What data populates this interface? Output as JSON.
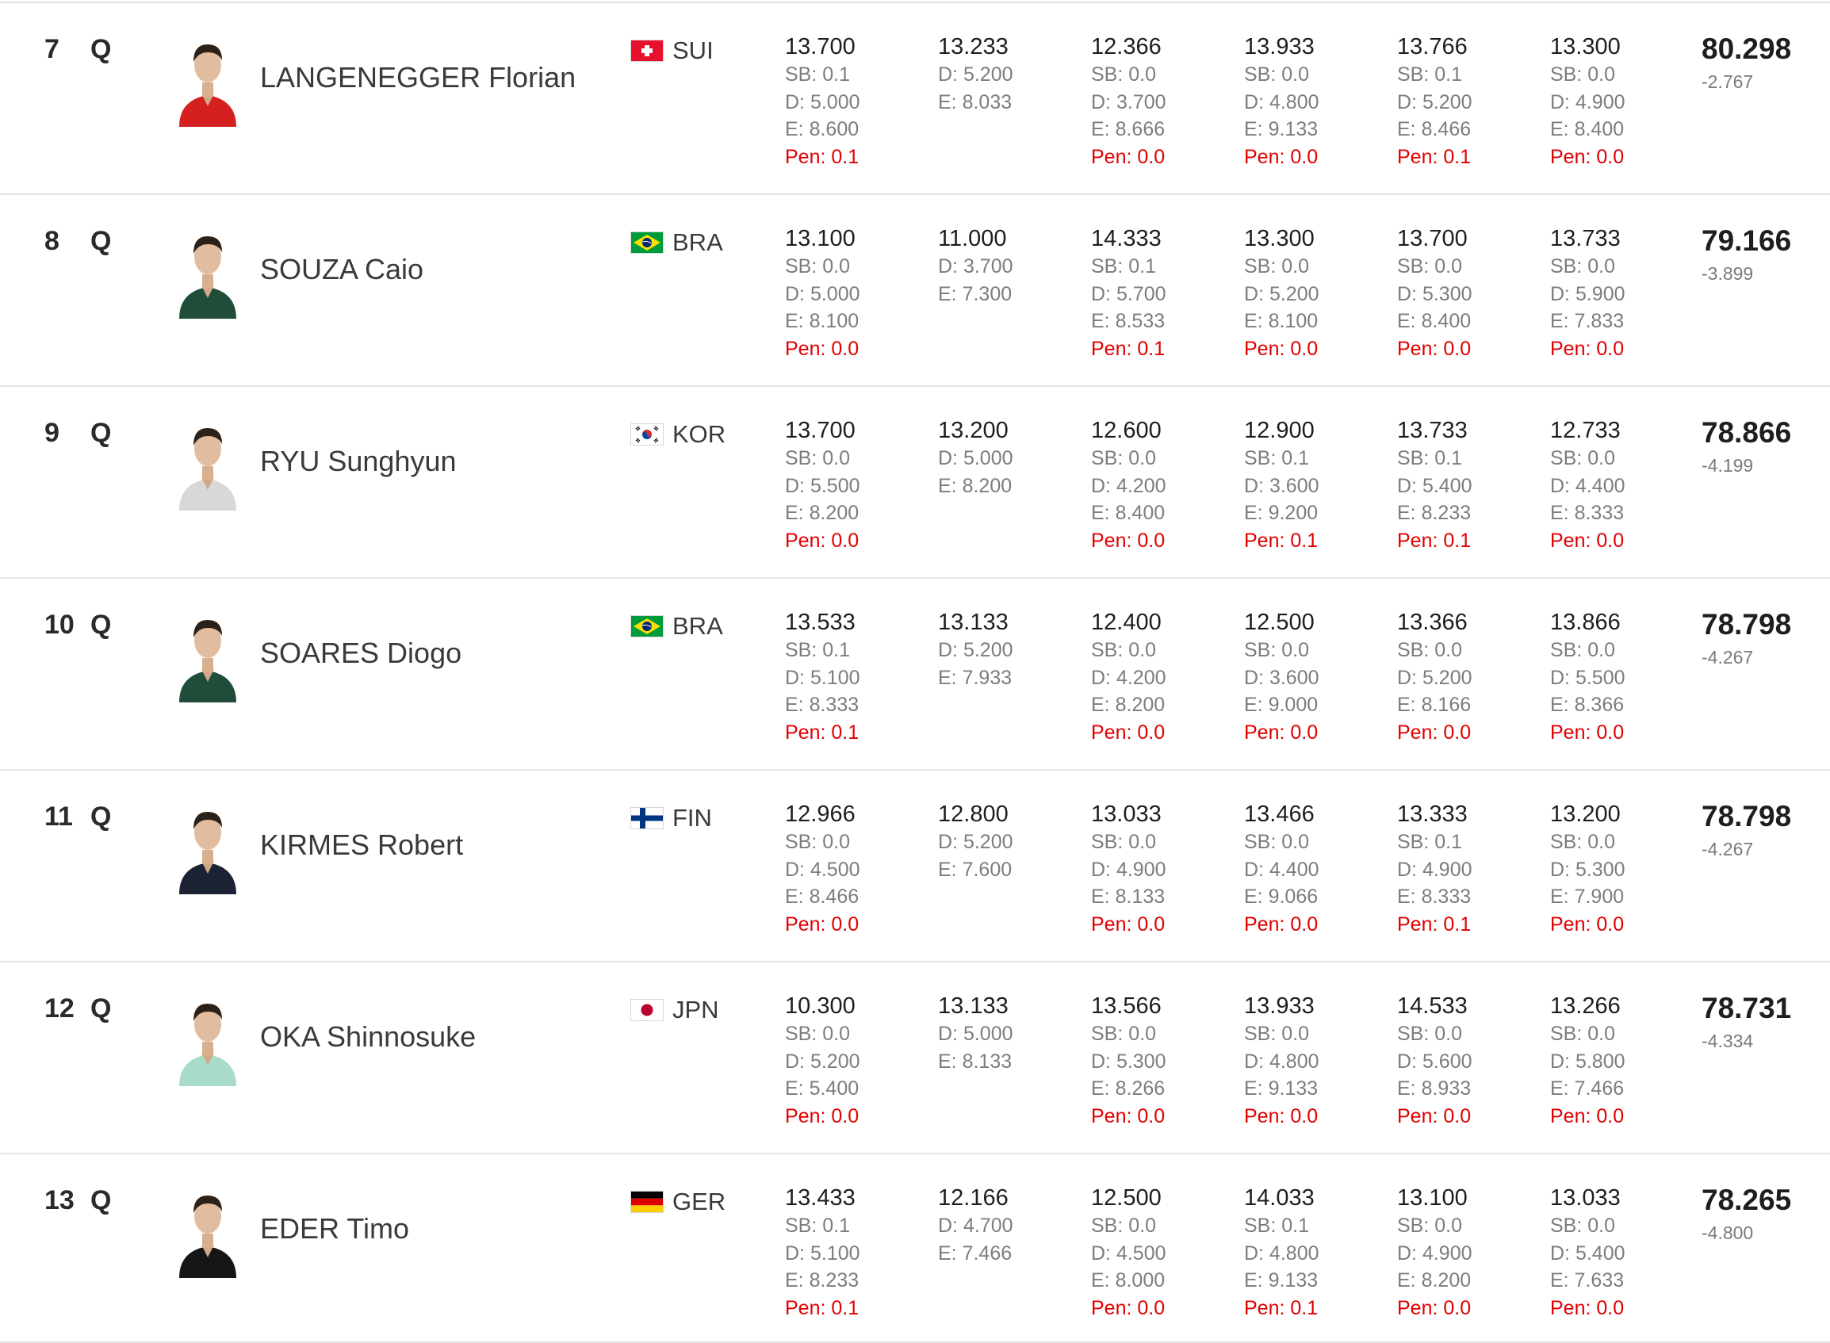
{
  "rows": [
    {
      "rank": "7",
      "q": "Q",
      "name": "LANGENEGGER Florian",
      "country": "SUI",
      "flag": "SUI",
      "jersey_color": "#d42020",
      "apps": [
        {
          "score": "13.700",
          "sb": "SB: 0.1",
          "d": "D: 5.000",
          "e": "E: 8.600",
          "pen": "Pen: 0.1"
        },
        {
          "score": "13.233",
          "sb": "",
          "d": "D: 5.200",
          "e": "E: 8.033",
          "pen": ""
        },
        {
          "score": "12.366",
          "sb": "SB: 0.0",
          "d": "D: 3.700",
          "e": "E: 8.666",
          "pen": "Pen: 0.0"
        },
        {
          "score": "13.933",
          "sb": "SB: 0.0",
          "d": "D: 4.800",
          "e": "E: 9.133",
          "pen": "Pen: 0.0"
        },
        {
          "score": "13.766",
          "sb": "SB: 0.1",
          "d": "D: 5.200",
          "e": "E: 8.466",
          "pen": "Pen: 0.1"
        },
        {
          "score": "13.300",
          "sb": "SB: 0.0",
          "d": "D: 4.900",
          "e": "E: 8.400",
          "pen": "Pen: 0.0"
        }
      ],
      "total": "80.298",
      "gap": "-2.767"
    },
    {
      "rank": "8",
      "q": "Q",
      "name": "SOUZA Caio",
      "country": "BRA",
      "flag": "BRA",
      "jersey_color": "#1f4d3a",
      "apps": [
        {
          "score": "13.100",
          "sb": "SB: 0.0",
          "d": "D: 5.000",
          "e": "E: 8.100",
          "pen": "Pen: 0.0"
        },
        {
          "score": "11.000",
          "sb": "",
          "d": "D: 3.700",
          "e": "E: 7.300",
          "pen": ""
        },
        {
          "score": "14.333",
          "sb": "SB: 0.1",
          "d": "D: 5.700",
          "e": "E: 8.533",
          "pen": "Pen: 0.1"
        },
        {
          "score": "13.300",
          "sb": "SB: 0.0",
          "d": "D: 5.200",
          "e": "E: 8.100",
          "pen": "Pen: 0.0"
        },
        {
          "score": "13.700",
          "sb": "SB: 0.0",
          "d": "D: 5.300",
          "e": "E: 8.400",
          "pen": "Pen: 0.0"
        },
        {
          "score": "13.733",
          "sb": "SB: 0.0",
          "d": "D: 5.900",
          "e": "E: 7.833",
          "pen": "Pen: 0.0"
        }
      ],
      "total": "79.166",
      "gap": "-3.899"
    },
    {
      "rank": "9",
      "q": "Q",
      "name": "RYU Sunghyun",
      "country": "KOR",
      "flag": "KOR",
      "jersey_color": "#d8d8d8",
      "apps": [
        {
          "score": "13.700",
          "sb": "SB: 0.0",
          "d": "D: 5.500",
          "e": "E: 8.200",
          "pen": "Pen: 0.0"
        },
        {
          "score": "13.200",
          "sb": "",
          "d": "D: 5.000",
          "e": "E: 8.200",
          "pen": ""
        },
        {
          "score": "12.600",
          "sb": "SB: 0.0",
          "d": "D: 4.200",
          "e": "E: 8.400",
          "pen": "Pen: 0.0"
        },
        {
          "score": "12.900",
          "sb": "SB: 0.1",
          "d": "D: 3.600",
          "e": "E: 9.200",
          "pen": "Pen: 0.1"
        },
        {
          "score": "13.733",
          "sb": "SB: 0.1",
          "d": "D: 5.400",
          "e": "E: 8.233",
          "pen": "Pen: 0.1"
        },
        {
          "score": "12.733",
          "sb": "SB: 0.0",
          "d": "D: 4.400",
          "e": "E: 8.333",
          "pen": "Pen: 0.0"
        }
      ],
      "total": "78.866",
      "gap": "-4.199"
    },
    {
      "rank": "10",
      "q": "Q",
      "name": "SOARES Diogo",
      "country": "BRA",
      "flag": "BRA",
      "jersey_color": "#1f4d3a",
      "apps": [
        {
          "score": "13.533",
          "sb": "SB: 0.1",
          "d": "D: 5.100",
          "e": "E: 8.333",
          "pen": "Pen: 0.1"
        },
        {
          "score": "13.133",
          "sb": "",
          "d": "D: 5.200",
          "e": "E: 7.933",
          "pen": ""
        },
        {
          "score": "12.400",
          "sb": "SB: 0.0",
          "d": "D: 4.200",
          "e": "E: 8.200",
          "pen": "Pen: 0.0"
        },
        {
          "score": "12.500",
          "sb": "SB: 0.0",
          "d": "D: 3.600",
          "e": "E: 9.000",
          "pen": "Pen: 0.0"
        },
        {
          "score": "13.366",
          "sb": "SB: 0.0",
          "d": "D: 5.200",
          "e": "E: 8.166",
          "pen": "Pen: 0.0"
        },
        {
          "score": "13.866",
          "sb": "SB: 0.0",
          "d": "D: 5.500",
          "e": "E: 8.366",
          "pen": "Pen: 0.0"
        }
      ],
      "total": "78.798",
      "gap": "-4.267"
    },
    {
      "rank": "11",
      "q": "Q",
      "name": "KIRMES Robert",
      "country": "FIN",
      "flag": "FIN",
      "jersey_color": "#1b2233",
      "apps": [
        {
          "score": "12.966",
          "sb": "SB: 0.0",
          "d": "D: 4.500",
          "e": "E: 8.466",
          "pen": "Pen: 0.0"
        },
        {
          "score": "12.800",
          "sb": "",
          "d": "D: 5.200",
          "e": "E: 7.600",
          "pen": ""
        },
        {
          "score": "13.033",
          "sb": "SB: 0.0",
          "d": "D: 4.900",
          "e": "E: 8.133",
          "pen": "Pen: 0.0"
        },
        {
          "score": "13.466",
          "sb": "SB: 0.0",
          "d": "D: 4.400",
          "e": "E: 9.066",
          "pen": "Pen: 0.0"
        },
        {
          "score": "13.333",
          "sb": "SB: 0.1",
          "d": "D: 4.900",
          "e": "E: 8.333",
          "pen": "Pen: 0.1"
        },
        {
          "score": "13.200",
          "sb": "SB: 0.0",
          "d": "D: 5.300",
          "e": "E: 7.900",
          "pen": "Pen: 0.0"
        }
      ],
      "total": "78.798",
      "gap": "-4.267"
    },
    {
      "rank": "12",
      "q": "Q",
      "name": "OKA Shinnosuke",
      "country": "JPN",
      "flag": "JPN",
      "jersey_color": "#a8dcc8",
      "apps": [
        {
          "score": "10.300",
          "sb": "SB: 0.0",
          "d": "D: 5.200",
          "e": "E: 5.400",
          "pen": "Pen: 0.0"
        },
        {
          "score": "13.133",
          "sb": "",
          "d": "D: 5.000",
          "e": "E: 8.133",
          "pen": ""
        },
        {
          "score": "13.566",
          "sb": "SB: 0.0",
          "d": "D: 5.300",
          "e": "E: 8.266",
          "pen": "Pen: 0.0"
        },
        {
          "score": "13.933",
          "sb": "SB: 0.0",
          "d": "D: 4.800",
          "e": "E: 9.133",
          "pen": "Pen: 0.0"
        },
        {
          "score": "14.533",
          "sb": "SB: 0.0",
          "d": "D: 5.600",
          "e": "E: 8.933",
          "pen": "Pen: 0.0"
        },
        {
          "score": "13.266",
          "sb": "SB: 0.0",
          "d": "D: 5.800",
          "e": "E: 7.466",
          "pen": "Pen: 0.0"
        }
      ],
      "total": "78.731",
      "gap": "-4.334"
    },
    {
      "rank": "13",
      "q": "Q",
      "name": "EDER Timo",
      "country": "GER",
      "flag": "GER",
      "jersey_color": "#161616",
      "apps": [
        {
          "score": "13.433",
          "sb": "SB: 0.1",
          "d": "D: 5.100",
          "e": "E: 8.233",
          "pen": "Pen: 0.1"
        },
        {
          "score": "12.166",
          "sb": "",
          "d": "D: 4.700",
          "e": "E: 7.466",
          "pen": ""
        },
        {
          "score": "12.500",
          "sb": "SB: 0.0",
          "d": "D: 4.500",
          "e": "E: 8.000",
          "pen": "Pen: 0.0"
        },
        {
          "score": "14.033",
          "sb": "SB: 0.1",
          "d": "D: 4.800",
          "e": "E: 9.133",
          "pen": "Pen: 0.1"
        },
        {
          "score": "13.100",
          "sb": "SB: 0.0",
          "d": "D: 4.900",
          "e": "E: 8.200",
          "pen": "Pen: 0.0"
        },
        {
          "score": "13.033",
          "sb": "SB: 0.0",
          "d": "D: 5.400",
          "e": "E: 7.633",
          "pen": "Pen: 0.0"
        }
      ],
      "total": "78.265",
      "gap": "-4.800"
    }
  ],
  "colors": {
    "penalty": "#e10000",
    "subscore": "#7d7d7d",
    "divider": "#e3e3e3"
  }
}
